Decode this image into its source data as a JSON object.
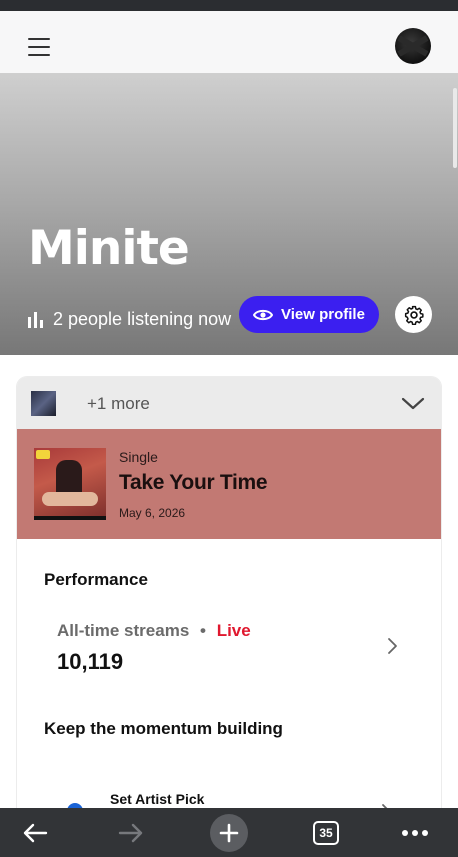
{
  "colors": {
    "accent": "#3b1ff0",
    "release_banner": "#c27973",
    "live": "#e0182f",
    "bottom_bar": "#323437"
  },
  "topbar": {
    "menu_icon": "hamburger-menu-icon",
    "avatar_icon": "user-avatar"
  },
  "hero": {
    "artist_name": "Minite",
    "listeners_icon": "bar-chart-icon",
    "listeners_text": "2 people listening now",
    "view_profile_icon": "eye-icon",
    "view_profile_label": "View profile",
    "settings_icon": "gear-icon"
  },
  "release_selector": {
    "more_label": "+1 more",
    "chevron_icon": "chevron-down-icon"
  },
  "release": {
    "type": "Single",
    "title": "Take Your Time",
    "date": "May 6, 2026"
  },
  "performance": {
    "section_title": "Performance",
    "streams_label": "All-time streams",
    "separator": "•",
    "live_label": "Live",
    "streams_value": "10,119"
  },
  "momentum": {
    "section_title": "Keep the momentum building",
    "artist_pick_label": "Set Artist Pick"
  },
  "browser_nav": {
    "back_icon": "back-arrow-icon",
    "forward_icon": "forward-arrow-icon",
    "new_tab_icon": "plus-icon",
    "tab_count": "35",
    "menu_icon": "more-dots-icon"
  }
}
